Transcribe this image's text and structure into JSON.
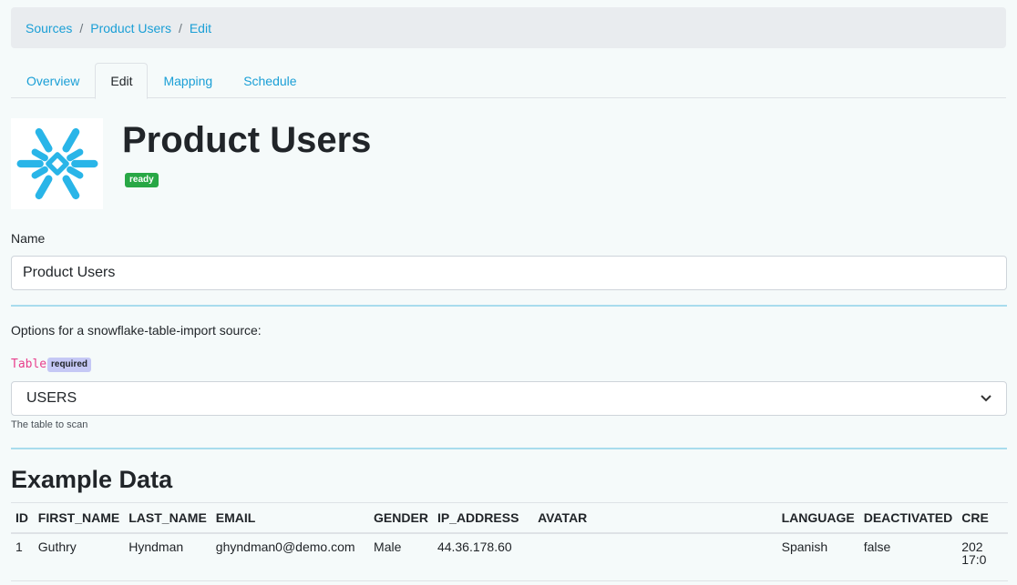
{
  "breadcrumb": {
    "items": [
      "Sources",
      "Product Users",
      "Edit"
    ],
    "separator": "/"
  },
  "tabs": [
    {
      "label": "Overview",
      "active": false
    },
    {
      "label": "Edit",
      "active": true
    },
    {
      "label": "Mapping",
      "active": false
    },
    {
      "label": "Schedule",
      "active": false
    }
  ],
  "header": {
    "logo_icon": "snowflake-icon",
    "title": "Product Users",
    "status": "ready"
  },
  "form": {
    "name_label": "Name",
    "name_value": "Product Users",
    "options_text": "Options for a snowflake-table-import source:",
    "table_label": "Table",
    "required_badge": "required",
    "table_value": "USERS",
    "table_help": "The table to scan"
  },
  "example": {
    "title": "Example Data",
    "columns": [
      "ID",
      "FIRST_NAME",
      "LAST_NAME",
      "EMAIL",
      "GENDER",
      "IP_ADDRESS",
      "AVATAR",
      "LANGUAGE",
      "DEACTIVATED",
      "CRE"
    ],
    "rows": [
      {
        "ID": "1",
        "FIRST_NAME": "Guthry",
        "LAST_NAME": "Hyndman",
        "EMAIL": "ghyndman0@demo.com",
        "GENDER": "Male",
        "IP_ADDRESS": "44.36.178.60",
        "AVATAR": "",
        "LANGUAGE": "Spanish",
        "DEACTIVATED": "false",
        "CRE_line1": "202",
        "CRE_line2": "17:0"
      }
    ]
  },
  "colors": {
    "link": "#1a9fd6",
    "ready_badge": "#28a745",
    "required_badge": "#c5c8f5",
    "code_label": "#e83e8c",
    "divider": "#a8dced",
    "snowflake": "#29b5e8"
  }
}
